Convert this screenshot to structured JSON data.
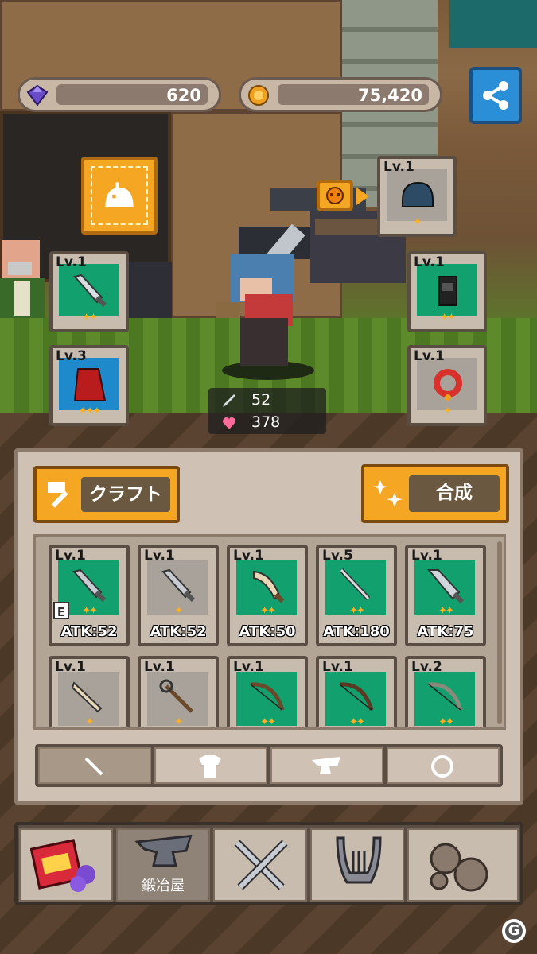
{
  "currency": {
    "gems": "620",
    "gold": "75,420"
  },
  "equipment_slots": [
    {
      "level": "Lv.1",
      "item": "sword",
      "stars": "✦✦"
    },
    {
      "level": "Lv.3",
      "item": "cape",
      "stars": "✦✦✦"
    },
    {
      "level": "Lv.1",
      "item": "helmet",
      "stars": "✦"
    },
    {
      "level": "Lv.1",
      "item": "armor",
      "stars": "✦✦"
    },
    {
      "level": "Lv.1",
      "item": "ring",
      "stars": "✦"
    }
  ],
  "hero_stats": {
    "attack": "52",
    "hp": "378"
  },
  "panel": {
    "craft_label": "クラフト",
    "synth_label": "合成"
  },
  "inventory_row1": [
    {
      "level": "Lv.1",
      "atk": "ATK:52",
      "stars": "✦✦",
      "bg": "green",
      "equipped": "E"
    },
    {
      "level": "Lv.1",
      "atk": "ATK:52",
      "stars": "✦",
      "bg": "gray"
    },
    {
      "level": "Lv.1",
      "atk": "ATK:50",
      "stars": "✦✦",
      "bg": "green"
    },
    {
      "level": "Lv.5",
      "atk": "ATK:180",
      "stars": "✦✦",
      "bg": "green"
    },
    {
      "level": "Lv.1",
      "atk": "ATK:75",
      "stars": "✦✦",
      "bg": "green"
    }
  ],
  "inventory_row2": [
    {
      "level": "Lv.1",
      "stars": "✦",
      "bg": "gray"
    },
    {
      "level": "Lv.1",
      "stars": "✦",
      "bg": "gray"
    },
    {
      "level": "Lv.1",
      "stars": "✦✦",
      "bg": "green"
    },
    {
      "level": "Lv.1",
      "stars": "✦✦",
      "bg": "green"
    },
    {
      "level": "Lv.2",
      "stars": "✦✦",
      "bg": "green"
    }
  ],
  "category_tabs": [
    "weapon",
    "armor",
    "anvil",
    "ring"
  ],
  "nav": {
    "smithy_label": "鍛冶屋"
  },
  "colors": {
    "accent_orange": "#f5a623",
    "item_green": "#12a06e",
    "share_blue": "#2a8fd6",
    "star_gold": "#ffb01f"
  }
}
